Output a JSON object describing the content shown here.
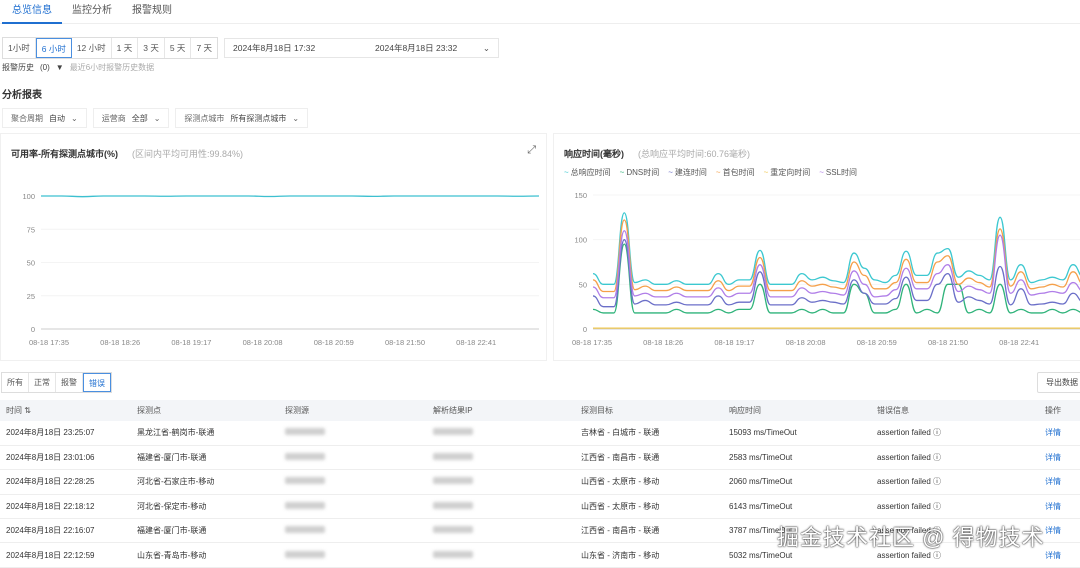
{
  "tabs": [
    "总览信息",
    "监控分析",
    "报警规则"
  ],
  "time_presets": [
    "1小时",
    "6 小时",
    "12 小时",
    "1 天",
    "3 天",
    "5 天",
    "7 天"
  ],
  "selected_preset": "6 小时",
  "range": {
    "start": "2024年8月18日 17:32",
    "end": "2024年8月18日 23:32"
  },
  "alarm_history": {
    "label": "报警历史",
    "count": "(0)",
    "note": "最近6小时报警历史数据"
  },
  "section_title": "分析报表",
  "filters": [
    {
      "label": "聚合周期",
      "value": "自动"
    },
    {
      "label": "运营商",
      "value": "全部"
    },
    {
      "label": "探测点城市",
      "value": "所有探测点城市"
    }
  ],
  "chart_data": [
    {
      "type": "line",
      "title": "可用率-所有探测点城市(%)",
      "subtitle": "(区间内平均可用性:99.84%)",
      "ylim": [
        0,
        100
      ],
      "yticks": [
        0,
        25,
        50,
        75,
        100
      ],
      "categories": [
        "08-18 17:35",
        "08-18 18:26",
        "08-18 19:17",
        "08-18 20:08",
        "08-18 20:59",
        "08-18 21:50",
        "08-18 22:41"
      ],
      "series": [
        {
          "color": "#3cc0d0",
          "values": [
            100,
            100,
            99.5,
            100,
            100,
            100,
            99.8,
            100,
            100,
            100,
            100,
            99.6,
            100,
            100,
            100,
            100,
            99.7,
            100,
            100,
            100,
            100,
            100,
            100,
            99.8,
            100
          ]
        }
      ]
    },
    {
      "type": "line",
      "title": "响应时间(毫秒)",
      "subtitle": "(总响应平均时间:60.76毫秒)",
      "ylim": [
        0,
        150
      ],
      "yticks": [
        0,
        50,
        100,
        150
      ],
      "categories": [
        "08-18 17:35",
        "08-18 18:26",
        "08-18 19:17",
        "08-18 20:08",
        "08-18 20:59",
        "08-18 21:50",
        "08-18 22:41"
      ],
      "series": [
        {
          "name": "总响应时间",
          "color": "#3cc8d0",
          "values": [
            62,
            50,
            50,
            130,
            52,
            55,
            50,
            50,
            54,
            50,
            50,
            50,
            62,
            50,
            55,
            55,
            88,
            50,
            50,
            50,
            62,
            55,
            58,
            54,
            52,
            85,
            68,
            55,
            52,
            60,
            87,
            60,
            60,
            85,
            90,
            58,
            65,
            60,
            55,
            125,
            55,
            72,
            52,
            55,
            58,
            55,
            72,
            58,
            57
          ]
        },
        {
          "name": "DNS时间",
          "color": "#2fb37a",
          "values": [
            22,
            18,
            18,
            95,
            18,
            18,
            18,
            18,
            22,
            18,
            18,
            18,
            22,
            18,
            22,
            22,
            50,
            18,
            18,
            18,
            22,
            18,
            22,
            18,
            18,
            50,
            40,
            18,
            18,
            22,
            50,
            18,
            22,
            18,
            50,
            50,
            18,
            22,
            18,
            50,
            18,
            22,
            18,
            18,
            22,
            18,
            22,
            18,
            18
          ]
        },
        {
          "name": "建连时间",
          "color": "#6b6fc8",
          "values": [
            37,
            25,
            25,
            100,
            28,
            32,
            27,
            27,
            30,
            27,
            27,
            27,
            37,
            27,
            30,
            30,
            64,
            27,
            27,
            27,
            35,
            30,
            32,
            30,
            28,
            55,
            40,
            28,
            28,
            34,
            58,
            32,
            32,
            50,
            62,
            30,
            36,
            32,
            28,
            70,
            27,
            45,
            27,
            28,
            30,
            28,
            40,
            30,
            29
          ]
        },
        {
          "name": "首包时间",
          "color": "#f5a04a",
          "values": [
            55,
            42,
            42,
            122,
            44,
            48,
            43,
            43,
            47,
            43,
            43,
            43,
            54,
            43,
            48,
            48,
            80,
            43,
            43,
            43,
            54,
            48,
            50,
            47,
            45,
            75,
            60,
            45,
            45,
            52,
            78,
            52,
            52,
            75,
            82,
            50,
            57,
            52,
            47,
            112,
            48,
            64,
            45,
            47,
            50,
            47,
            64,
            50,
            49
          ]
        },
        {
          "name": "重定向时间",
          "color": "#f0c850",
          "values": [
            1,
            1,
            1,
            1,
            1,
            1,
            1,
            1,
            1,
            1,
            1,
            1,
            1,
            1,
            1,
            1,
            1,
            1,
            1,
            1,
            1,
            1,
            1,
            1,
            1,
            1,
            1,
            1,
            1,
            1,
            1,
            1,
            1,
            1,
            1,
            1,
            1,
            1,
            1,
            1,
            1,
            1,
            1,
            1,
            1,
            1,
            1,
            1,
            1
          ]
        },
        {
          "name": "SSL时间",
          "color": "#b07ee8",
          "values": [
            47,
            35,
            35,
            110,
            37,
            40,
            36,
            36,
            40,
            36,
            36,
            36,
            46,
            36,
            40,
            40,
            72,
            36,
            36,
            36,
            46,
            40,
            42,
            40,
            38,
            65,
            50,
            36,
            37,
            44,
            68,
            45,
            45,
            62,
            72,
            42,
            48,
            44,
            40,
            105,
            40,
            55,
            38,
            40,
            42,
            40,
            52,
            42,
            41
          ]
        }
      ]
    }
  ],
  "status_filters": [
    "所有",
    "正常",
    "报警",
    "错误"
  ],
  "selected_status": "错误",
  "export_label": "导出数据",
  "table": {
    "headers": [
      "时间 ⇅",
      "探测点",
      "探测源",
      "解析结果IP",
      "探测目标",
      "响应时间",
      "错误信息",
      "操作"
    ],
    "rows": [
      [
        "2024年8月18日 23:25:07",
        "黑龙江省-鹤岗市-联通",
        "吉林省 - 白城市 - 联通",
        "15093 ms/TimeOut",
        "assertion failed ⓘ",
        "详情"
      ],
      [
        "2024年8月18日 23:01:06",
        "福建省-厦门市-联通",
        "江西省 - 南昌市 - 联通",
        "2583 ms/TimeOut",
        "assertion failed ⓘ",
        "详情"
      ],
      [
        "2024年8月18日 22:28:25",
        "河北省-石家庄市-移动",
        "山西省 - 太原市 - 移动",
        "2060 ms/TimeOut",
        "assertion failed ⓘ",
        "详情"
      ],
      [
        "2024年8月18日 22:18:12",
        "河北省-保定市-移动",
        "山西省 - 太原市 - 移动",
        "6143 ms/TimeOut",
        "assertion failed ⓘ",
        "详情"
      ],
      [
        "2024年8月18日 22:16:07",
        "福建省-厦门市-联通",
        "江西省 - 南昌市 - 联通",
        "3787 ms/TimeOut",
        "assertion failed ⓘ",
        "详情"
      ],
      [
        "2024年8月18日 22:12:59",
        "山东省-青岛市-移动",
        "山东省 - 济南市 - 移动",
        "5032 ms/TimeOut",
        "assertion failed ⓘ",
        "详情"
      ]
    ]
  },
  "watermark": "掘金技术社区 @ 得物技术"
}
